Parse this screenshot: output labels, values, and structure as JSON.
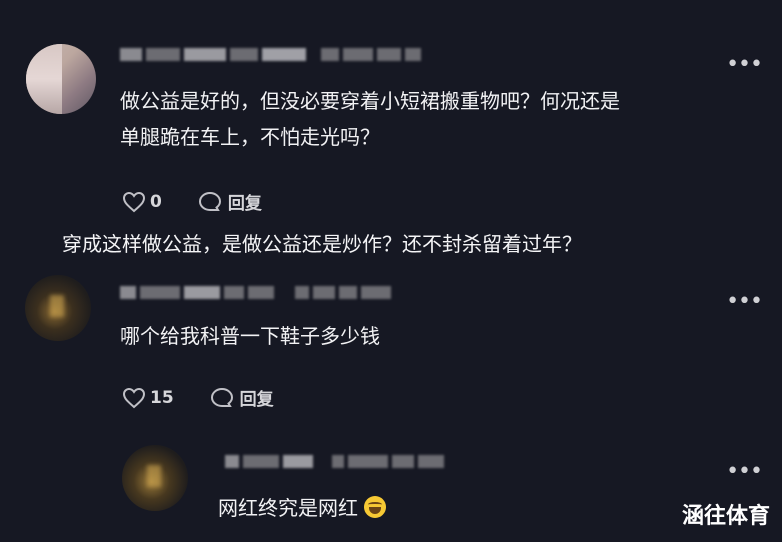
{
  "comments": [
    {
      "text_line1": "做公益是好的，但没必要穿着小短裙搬重物吧？何况还是",
      "text_line2": "单腿跪在车上，不怕走光吗？",
      "likes": "0",
      "reply_label": "回复"
    },
    {
      "text": "哪个给我科普一下鞋子多少钱",
      "likes": "15",
      "reply_label": "回复"
    },
    {
      "text": "网红终究是网红"
    }
  ],
  "caption": "穿成这样做公益，是做公益还是炒作？还不封杀留着过年？",
  "watermark": "涵往体育",
  "icons": {
    "like": "heart-icon",
    "reply": "speech-bubble-icon",
    "more": "more-options-icon",
    "emoji": "laughing-tears-emoji"
  },
  "colors": {
    "background": "#161823",
    "text": "#f2f2f4",
    "meta": "#b8b8be"
  }
}
